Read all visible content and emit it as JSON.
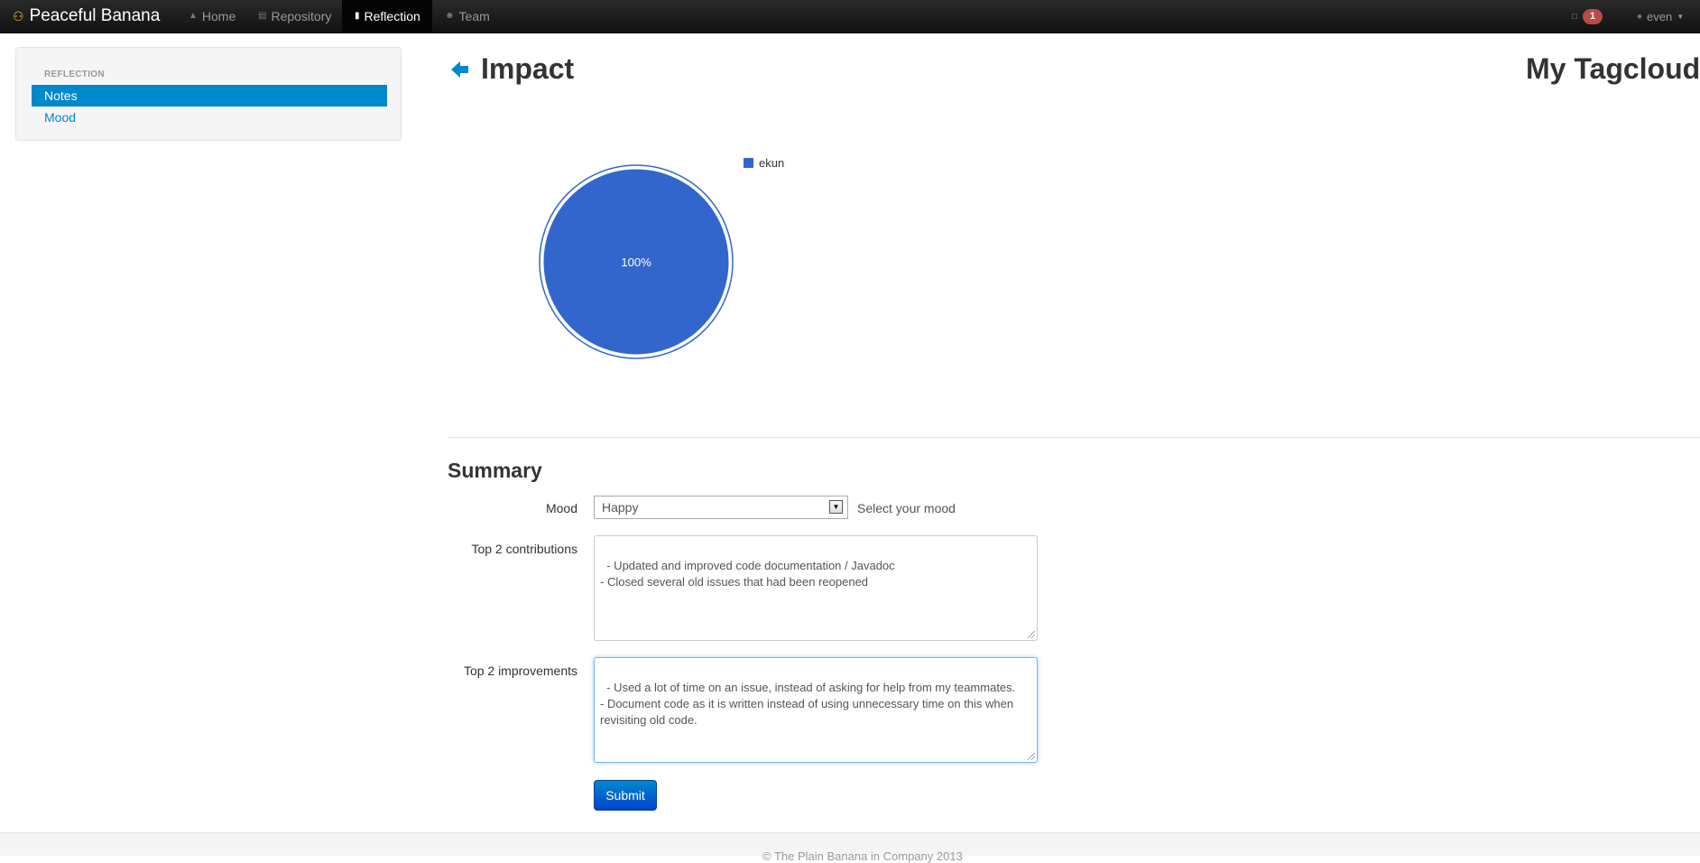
{
  "navbar": {
    "brand": "Peaceful Banana",
    "brand_icon": "banana-icon",
    "items": [
      {
        "label": "Home",
        "icon": "home-icon"
      },
      {
        "label": "Repository",
        "icon": "folder-icon"
      },
      {
        "label": "Reflection",
        "icon": "book-icon",
        "active": true
      },
      {
        "label": "Team",
        "icon": "team-icon"
      }
    ],
    "notification_count": "1",
    "user": "even"
  },
  "sidebar": {
    "header": "REFLECTION",
    "items": [
      {
        "label": "Notes",
        "active": true
      },
      {
        "label": "Mood",
        "active": false
      }
    ]
  },
  "impact": {
    "title": "Impact",
    "tagcloud_title": "My Tagcloud"
  },
  "chart_data": {
    "type": "pie",
    "slices": [
      {
        "label": "ekun",
        "value": 100,
        "display": "100%",
        "color": "#3366cc"
      }
    ],
    "legend": [
      "ekun"
    ],
    "legend_position": "top-right"
  },
  "summary": {
    "title": "Summary",
    "mood_label": "Mood",
    "mood_value": "Happy",
    "mood_help": "Select your mood",
    "contributions_label": "Top 2 contributions",
    "contributions_value": "- Updated and improved code documentation / Javadoc\n- Closed several old issues that had been reopened",
    "improvements_label": "Top 2 improvements",
    "improvements_value": "- Used a lot of time on an issue, instead of asking for help from my teammates.\n- Document code as it is written instead of using unnecessary time on this when revisiting old code. ",
    "submit_label": "Submit"
  },
  "footer": {
    "text": "© The Plain Banana in Company 2013"
  }
}
